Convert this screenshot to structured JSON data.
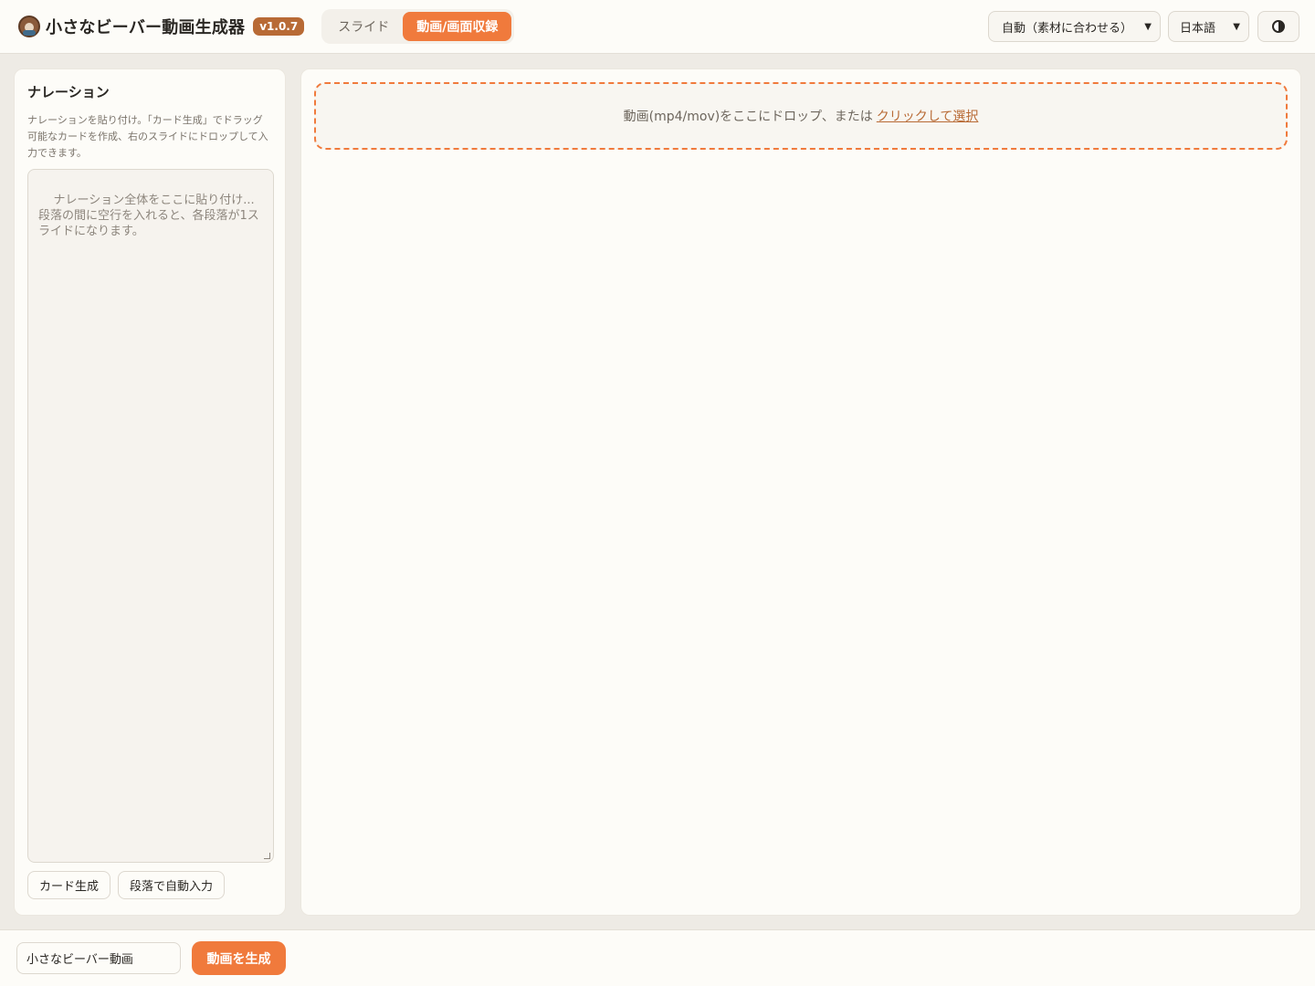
{
  "header": {
    "app_title": "小さなビーバー動画生成器",
    "version": "v1.0.7",
    "mode_tabs": [
      {
        "label": "スライド",
        "active": false
      },
      {
        "label": "動画/画面収録",
        "active": true
      }
    ],
    "aspect_select": {
      "value": "自動（素材に合わせる）",
      "icon": "chevron-down-icon"
    },
    "language_select": {
      "value": "日本語",
      "icon": "chevron-down-icon"
    },
    "theme_toggle": {
      "icon": "contrast-icon"
    }
  },
  "narration_panel": {
    "title": "ナレーション",
    "description": "ナレーションを貼り付け。「カード生成」でドラッグ可能なカードを作成、右のスライドにドロップして入力できます。",
    "textarea_placeholder": "ナレーション全体をここに貼り付け...\n段落の間に空行を入れると、各段落が1スライドになります。",
    "buttons": {
      "generate_cards": "カード生成",
      "auto_fill": "段落で自動入力"
    }
  },
  "video_panel": {
    "dropzone_text": "動画(mp4/mov)をここにドロップ、または",
    "dropzone_link": "クリックして選択"
  },
  "footer": {
    "title_input_value": "小さなビーバー動画",
    "generate_button": "動画を生成"
  },
  "colors": {
    "accent": "#f07a3c",
    "version_badge": "#b86a35",
    "background": "#eeebe5",
    "panel": "#fdfcf8"
  }
}
